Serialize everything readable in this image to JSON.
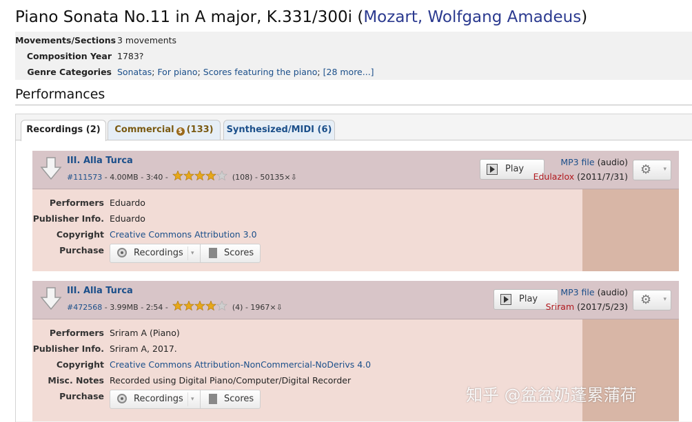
{
  "header": {
    "title": "Piano Sonata No.11 in A major, K.331/300i",
    "title_paren_open": "(",
    "composer": "Mozart, Wolfgang Amadeus",
    "title_paren_close": ")"
  },
  "info": [
    {
      "key": "Movements/Sections",
      "value": "3 movements"
    },
    {
      "key": "Composition Year",
      "value": "1783?"
    },
    {
      "key": "Genre Categories",
      "links": [
        "Sonatas",
        "For piano",
        "Scores featuring the piano"
      ],
      "more": "[28 more...]"
    }
  ],
  "section_title": "Performances",
  "tabs": [
    {
      "label": "Recordings (2)"
    },
    {
      "label_before": "Commercial",
      "label_after": "(133)"
    },
    {
      "label": "Synthesized/MIDI (6)"
    }
  ],
  "recordings": [
    {
      "title": "III. Alla Turca",
      "id": "#111573",
      "size": "4.00MB",
      "duration": "3:40",
      "rating": 4,
      "rating_count": "(108)",
      "downloads": "50135×⇩",
      "play_label": "Play",
      "file_type": "MP3 file",
      "file_kind": "(audio)",
      "uploader": "Edulazlox",
      "upload_date": "(2011/7/31)",
      "fields": [
        {
          "key": "Performers",
          "value": "Eduardo",
          "link": false
        },
        {
          "key": "Publisher Info.",
          "value": "Eduardo",
          "link": false
        },
        {
          "key": "Copyright",
          "value": "Creative Commons Attribution 3.0",
          "link": true
        }
      ],
      "purchase_label": "Purchase",
      "purchase_recordings": "Recordings",
      "purchase_scores": "Scores"
    },
    {
      "title": "III. Alla Turca",
      "id": "#472568",
      "size": "3.99MB",
      "duration": "2:54",
      "rating": 4,
      "rating_count": "(4)",
      "downloads": "1967×⇩",
      "play_label": "Play",
      "file_type": "MP3 file",
      "file_kind": "(audio)",
      "uploader": "Sriram",
      "upload_date": "(2017/5/23)",
      "fields": [
        {
          "key": "Performers",
          "value": "Sriram A (Piano)",
          "link": false
        },
        {
          "key": "Publisher Info.",
          "value": "Sriram A, 2017.",
          "link": false
        },
        {
          "key": "Copyright",
          "value": "Creative Commons Attribution-NonCommercial-NoDerivs 4.0",
          "link": true
        },
        {
          "key": "Misc. Notes",
          "value": "Recorded using Digital Piano/Computer/Digital Recorder",
          "link": false
        }
      ],
      "purchase_label": "Purchase",
      "purchase_recordings": "Recordings",
      "purchase_scores": "Scores"
    }
  ],
  "watermark": "知乎 @盆盆奶蓬累蒲荷",
  "colors": {
    "header_band": "#d8c5c8",
    "body_band": "#f2dcd6",
    "side_band": "#d8b6a6",
    "link": "#1b4f8a",
    "uploader": "#b0191e"
  }
}
